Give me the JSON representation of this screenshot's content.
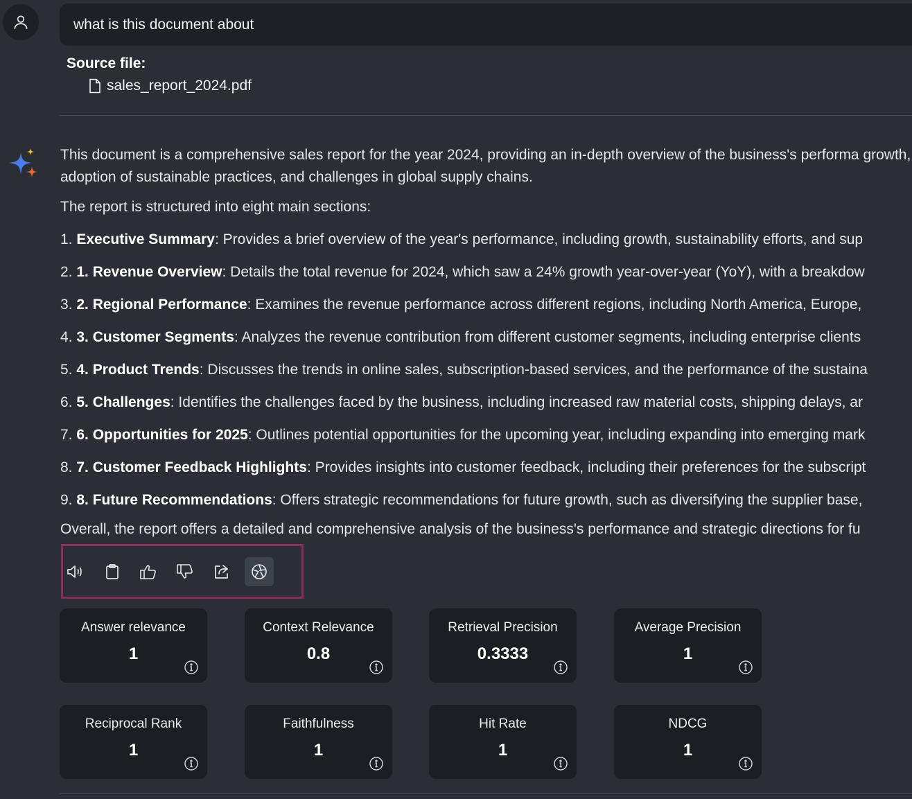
{
  "query": {
    "text": "what is this document about"
  },
  "source": {
    "label": "Source file:",
    "file_name": "sales_report_2024.pdf"
  },
  "answer": {
    "intro": "This document is a comprehensive sales report for the year 2024, providing an in-depth overview of the business's performa growth, the adoption of sustainable practices, and challenges in global supply chains.",
    "structure": "The report is structured into eight main sections:",
    "sections": [
      {
        "number": "1.",
        "title": "Executive Summary",
        "text": ": Provides a brief overview of the year's performance, including growth, sustainability efforts, and sup"
      },
      {
        "number": "2.",
        "title": "1. Revenue Overview",
        "text": ": Details the total revenue for 2024, which saw a 24% growth year-over-year (YoY), with a breakdow"
      },
      {
        "number": "3.",
        "title": "2. Regional Performance",
        "text": ": Examines the revenue performance across different regions, including North America, Europe,"
      },
      {
        "number": "4.",
        "title": "3. Customer Segments",
        "text": ": Analyzes the revenue contribution from different customer segments, including enterprise clients"
      },
      {
        "number": "5.",
        "title": "4. Product Trends",
        "text": ": Discusses the trends in online sales, subscription-based services, and the performance of the sustaina"
      },
      {
        "number": "6.",
        "title": "5. Challenges",
        "text": ": Identifies the challenges faced by the business, including increased raw material costs, shipping delays, ar"
      },
      {
        "number": "7.",
        "title": "6. Opportunities for 2025",
        "text": ": Outlines potential opportunities for the upcoming year, including expanding into emerging mark"
      },
      {
        "number": "8.",
        "title": "7. Customer Feedback Highlights",
        "text": ": Provides insights into customer feedback, including their preferences for the subscript"
      },
      {
        "number": "9.",
        "title": "8. Future Recommendations",
        "text": ": Offers strategic recommendations for future growth, such as diversifying the supplier base,"
      }
    ],
    "overall": "Overall, the report offers a detailed and comprehensive analysis of the business's performance and strategic directions for fu"
  },
  "actions": [
    {
      "name": "read-aloud",
      "icon": "speaker-icon"
    },
    {
      "name": "copy",
      "icon": "clipboard-icon"
    },
    {
      "name": "thumbs-up",
      "icon": "thumbs-up-icon"
    },
    {
      "name": "thumbs-down",
      "icon": "thumbs-down-icon"
    },
    {
      "name": "share",
      "icon": "share-icon"
    },
    {
      "name": "evaluate",
      "icon": "aperture-icon",
      "active": true
    }
  ],
  "metrics": [
    {
      "label": "Answer relevance",
      "value": "1"
    },
    {
      "label": "Context Relevance",
      "value": "0.8"
    },
    {
      "label": "Retrieval Precision",
      "value": "0.3333"
    },
    {
      "label": "Average Precision",
      "value": "1"
    },
    {
      "label": "Reciprocal Rank",
      "value": "1"
    },
    {
      "label": "Faithfulness",
      "value": "1"
    },
    {
      "label": "Hit Rate",
      "value": "1"
    },
    {
      "label": "NDCG",
      "value": "1"
    }
  ],
  "colors": {
    "background": "#2b2f35",
    "card": "#1b1e22",
    "highlight_border": "#8c2d55",
    "sparkle_blue": "#4a7cf0",
    "sparkle_orange": "#e8643c",
    "sparkle_yellow": "#f2c12e"
  }
}
